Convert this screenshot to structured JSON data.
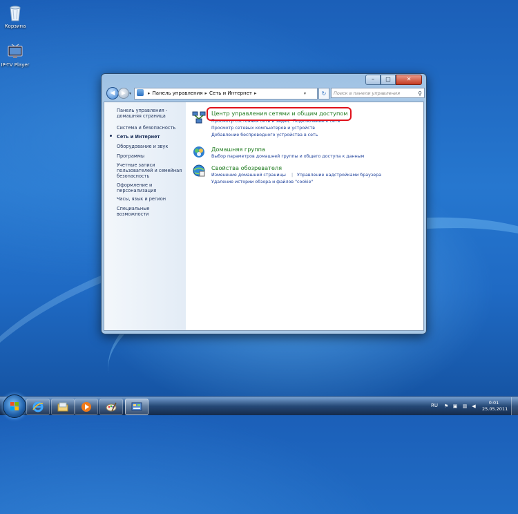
{
  "desktop": {
    "icons": [
      {
        "label": "Корзина",
        "icon": "recycle-bin-icon"
      },
      {
        "label": "IP-TV Player",
        "icon": "iptv-player-icon"
      }
    ]
  },
  "window": {
    "caption_buttons": {
      "minimize": "–",
      "maximize": "□",
      "close": "✕"
    },
    "nav": {
      "back": "◀",
      "forward": "▶"
    },
    "address": {
      "crumbs": [
        "Панель управления",
        "Сеть и Интернет"
      ],
      "separator": "▸"
    },
    "refresh": "↻",
    "search": {
      "placeholder": "Поиск в панели управления"
    },
    "sidebar": {
      "items": [
        {
          "label": "Панель управления - домашняя страница"
        },
        {
          "label": "Система и безопасность"
        },
        {
          "label": "Сеть и Интернет",
          "current": true
        },
        {
          "label": "Оборудование и звук"
        },
        {
          "label": "Программы"
        },
        {
          "label": "Учетные записи пользователей и семейная безопасность"
        },
        {
          "label": "Оформление и персонализация"
        },
        {
          "label": "Часы, язык и регион"
        },
        {
          "label": "Специальные возможности"
        }
      ]
    },
    "sections": [
      {
        "title": "Центр управления сетями и общим доступом",
        "icon": "network-center-icon",
        "highlighted": true,
        "links": [
          [
            "Просмотр состояния сети и задач",
            "Подключение к сети"
          ],
          [
            "Просмотр сетевых компьютеров и устройств"
          ],
          [
            "Добавление беспроводного устройства в сеть"
          ]
        ]
      },
      {
        "title": "Домашняя группа",
        "icon": "homegroup-icon",
        "links": [
          [
            "Выбор параметров домашней группы и общего доступа к данным"
          ]
        ]
      },
      {
        "title": "Свойства обозревателя",
        "icon": "internet-options-icon",
        "links": [
          [
            "Изменение домашней страницы",
            "Управление надстройками браузера"
          ],
          [
            "Удаление истории обзора и файлов \"cookie\""
          ]
        ]
      }
    ],
    "highlight_color": "#e0101a"
  },
  "taskbar": {
    "buttons": [
      {
        "name": "ie-icon",
        "active": false
      },
      {
        "name": "explorer-icon",
        "active": false
      },
      {
        "name": "media-player-icon",
        "active": false
      },
      {
        "name": "paint-icon",
        "active": false
      },
      {
        "name": "control-panel-icon",
        "active": true
      }
    ],
    "language": "RU",
    "clock": {
      "time": "0:01",
      "date": "25.05.2011"
    }
  }
}
